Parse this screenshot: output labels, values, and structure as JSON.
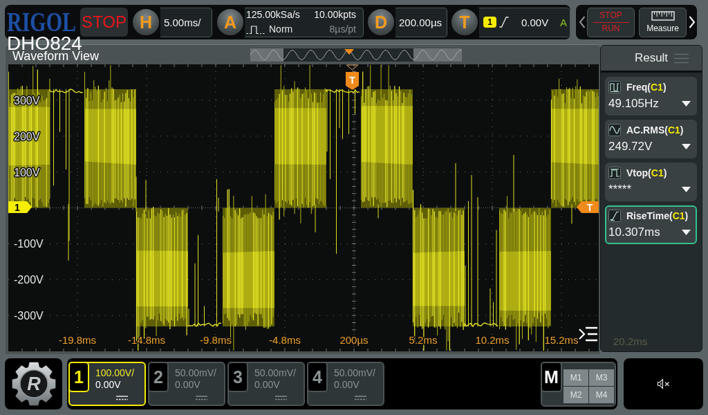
{
  "top_bar": {
    "logo": "RIGOL",
    "run_state": "STOP",
    "model": "DHO824",
    "horizontal": {
      "key": "H",
      "scale": "5.00ms/"
    },
    "acquisition": {
      "key": "A",
      "sample_rate": "125.00kSa/s",
      "memory_depth": "10.00kpts",
      "mode": "Norm",
      "time_per_point": "8µs/pt"
    },
    "delay": {
      "key": "D",
      "offset": "200.00µs"
    },
    "trigger": {
      "key": "T",
      "source": "1",
      "level": "0.00V",
      "sweep": "A"
    }
  },
  "toolbar": {
    "run_stop": {
      "stop": "STOP",
      "run": "RUN"
    },
    "measure": {
      "label": "Measure"
    }
  },
  "waveform_view": {
    "title": "Waveform View",
    "y_labels": [
      "300V",
      "200V",
      "100V",
      "-100V",
      "-200V",
      "-300V"
    ],
    "x_labels": [
      "-19.8ms",
      "-14.8ms",
      "-9.8ms",
      "-4.8ms",
      "200µs",
      "5.2ms",
      "10.2ms",
      "15.2ms",
      "20.2ms"
    ],
    "channel_marker": "1",
    "trigger_position_marker": "T",
    "trigger_level_marker": "T"
  },
  "result_panel": {
    "title": "Result",
    "measurements": [
      {
        "kind": "frequency",
        "title_start": "Freq(",
        "source": "C1",
        "title_end": ")",
        "value": "49.105Hz",
        "selected": false
      },
      {
        "kind": "rms",
        "title_start": "AC.RMS(",
        "source": "C1",
        "title_end": ")",
        "value": "249.72V",
        "selected": false
      },
      {
        "kind": "top",
        "title_start": "Vtop(",
        "source": "C1",
        "title_end": ")",
        "value": "*****",
        "selected": false
      },
      {
        "kind": "rise",
        "title_start": "RiseTime(",
        "source": "C1",
        "title_end": ")",
        "value": "10.307ms",
        "selected": true
      }
    ]
  },
  "bottom_bar": {
    "utility_logo": "R",
    "channels": [
      {
        "number": "1",
        "scale": "100.00V/",
        "offset": "0.00V",
        "on": true
      },
      {
        "number": "2",
        "scale": "50.00mV/",
        "offset": "0.00V",
        "on": false
      },
      {
        "number": "3",
        "scale": "50.00mV/",
        "offset": "0.00V",
        "on": false
      },
      {
        "number": "4",
        "scale": "50.00mV/",
        "offset": "0.00V",
        "on": false
      }
    ],
    "math": {
      "label": "M",
      "channels": [
        "M1",
        "M3",
        "M2",
        "M4"
      ]
    }
  }
}
